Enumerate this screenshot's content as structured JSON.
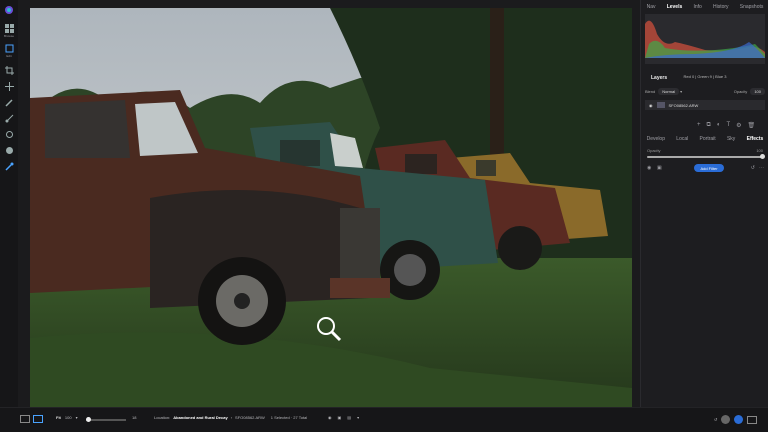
{
  "leftbar": {
    "items": [
      {
        "name": "browse-icon",
        "caption": "Browse"
      },
      {
        "name": "edit-icon",
        "caption": "Edit"
      }
    ]
  },
  "panel": {
    "tabs": [
      "Nav",
      "Levels",
      "Info",
      "History",
      "Snapshots"
    ],
    "active_tab": "Levels",
    "histogram_info": "Red 0 | Green 9 | Blue 3",
    "layers_title": "Layers",
    "blend_label": "Blend",
    "blend_value": "Normal",
    "opacity_label": "Opacity",
    "opacity_value": "100",
    "layer_name": "SFO08562.ARW",
    "subtabs": [
      "Develop",
      "Local",
      "Portrait",
      "Sky",
      "Effects"
    ],
    "active_subtab": "Effects",
    "effects_opacity_label": "Opacity",
    "effects_opacity_value": "100",
    "add_filter_label": "Add Filter"
  },
  "bottombar": {
    "fit_label": "Fit",
    "zoom_value": "100",
    "thumb_size": "18",
    "location_label": "Location:",
    "location_value": "Abandoned and Rural Decay",
    "location_file": "SFO08562.ARW",
    "selection_status": "1 Selected · 27 Total"
  },
  "colors": {
    "accent": "#2a6cd6",
    "panel_bg": "#1d1d20",
    "app_bg": "#1b1b1d"
  }
}
